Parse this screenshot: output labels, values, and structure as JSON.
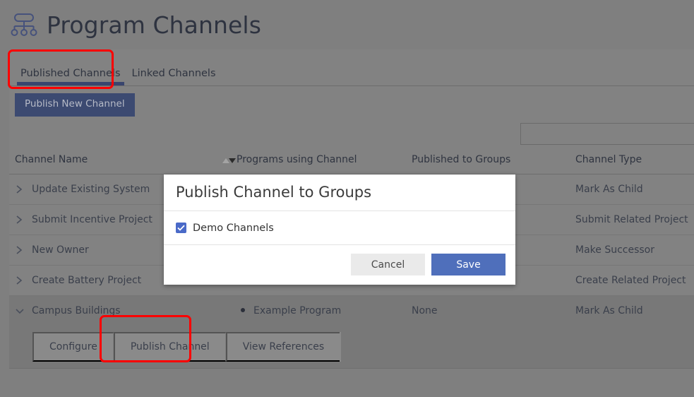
{
  "header": {
    "icon": "hierarchy-icon",
    "title": "Program Channels"
  },
  "tabs": [
    {
      "label": "Published Channels",
      "active": true
    },
    {
      "label": "Linked Channels",
      "active": false
    }
  ],
  "toolbar": {
    "publish_new_label": "Publish New Channel"
  },
  "search": {
    "value": "",
    "placeholder": ""
  },
  "table": {
    "columns": [
      {
        "label": "Channel Name",
        "sorted": false
      },
      {
        "label": "Programs using Channel",
        "sorted": true
      },
      {
        "label": "Published to Groups",
        "sorted": false
      },
      {
        "label": "Channel Type",
        "sorted": false
      }
    ],
    "rows": [
      {
        "name": "Update Existing System",
        "programs": "",
        "groups": "",
        "type": "Mark As Child",
        "expanded": false
      },
      {
        "name": "Submit Incentive Project",
        "programs": "",
        "groups": "",
        "type": "Submit Related Project",
        "expanded": false
      },
      {
        "name": "New Owner",
        "programs": "",
        "groups": "",
        "type": "Make Successor",
        "expanded": false
      },
      {
        "name": "Create Battery Project",
        "programs": "",
        "groups": "",
        "type": "Create Related Project",
        "expanded": false
      },
      {
        "name": "Campus Buildings",
        "programs": "Example Program",
        "groups": "None",
        "type": "Mark As Child",
        "expanded": true
      }
    ],
    "row_actions": [
      "Configure",
      "Publish Channel",
      "View References"
    ]
  },
  "modal": {
    "title": "Publish Channel to Groups",
    "groups": [
      {
        "label": "Demo Channels",
        "checked": true
      }
    ],
    "cancel_label": "Cancel",
    "save_label": "Save"
  },
  "colors": {
    "accent_navy": "#3c4a71",
    "accent_blue": "#4f6fbb",
    "checkbox_blue": "#4a6ac8",
    "highlight_red": "#fe0000",
    "page_bg": "#7f7f7f",
    "card_bg": "#828282"
  },
  "annotations": [
    {
      "target": "published-channels-tab",
      "color": "#fe0000"
    },
    {
      "target": "publish-channel-action",
      "color": "#fe0000"
    }
  ]
}
